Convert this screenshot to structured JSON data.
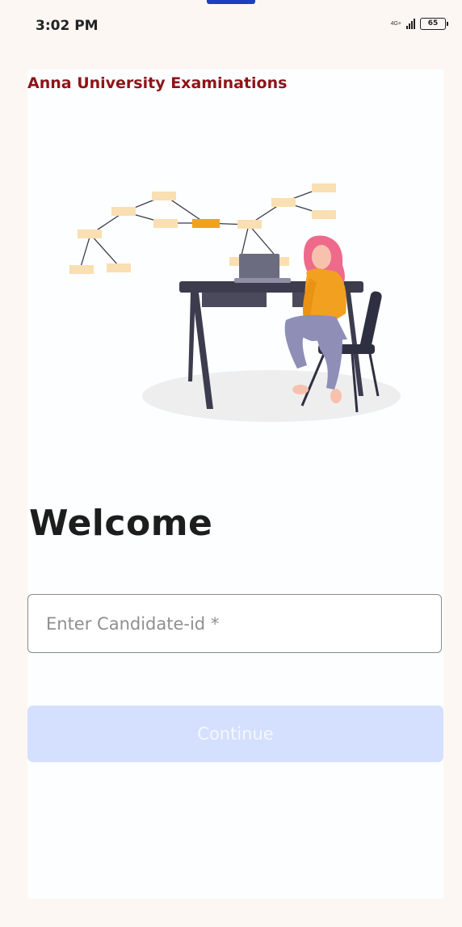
{
  "status_bar": {
    "time": "3:02 PM",
    "network_type": "4G+",
    "battery_level": "65"
  },
  "header": {
    "title": "Anna University Examinations"
  },
  "hero": {
    "illustration": "woman-at-desk-with-laptop-mind-map",
    "accent_color": "#f2a11c"
  },
  "main": {
    "welcome_heading": "Welcome",
    "candidate_input": {
      "placeholder": "Enter Candidate-id *",
      "value": ""
    },
    "continue_label": "Continue"
  },
  "colors": {
    "title": "#8e1418",
    "button_disabled_bg": "#d4e0fd",
    "page_bg": "#fdf7f4"
  }
}
